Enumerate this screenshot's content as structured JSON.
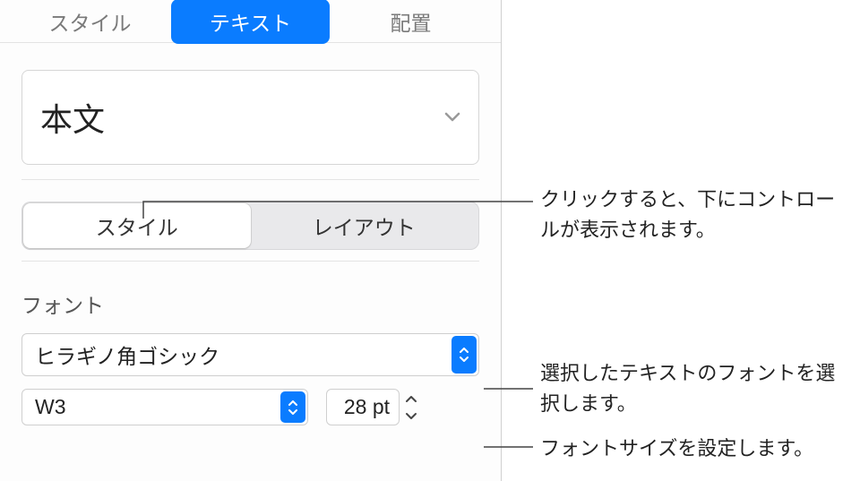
{
  "tabs": {
    "style": "スタイル",
    "text": "テキスト",
    "arrange": "配置"
  },
  "paragraph_style": {
    "label": "本文"
  },
  "segmented": {
    "style": "スタイル",
    "layout": "レイアウト"
  },
  "font": {
    "header": "フォント",
    "family": "ヒラギノ角ゴシック",
    "weight": "W3",
    "size": "28 pt"
  },
  "callouts": {
    "segmented": "クリックすると、下にコントロールが表示されます。",
    "font_family": "選択したテキストのフォントを選択します。",
    "font_size": "フォントサイズを設定します。"
  }
}
